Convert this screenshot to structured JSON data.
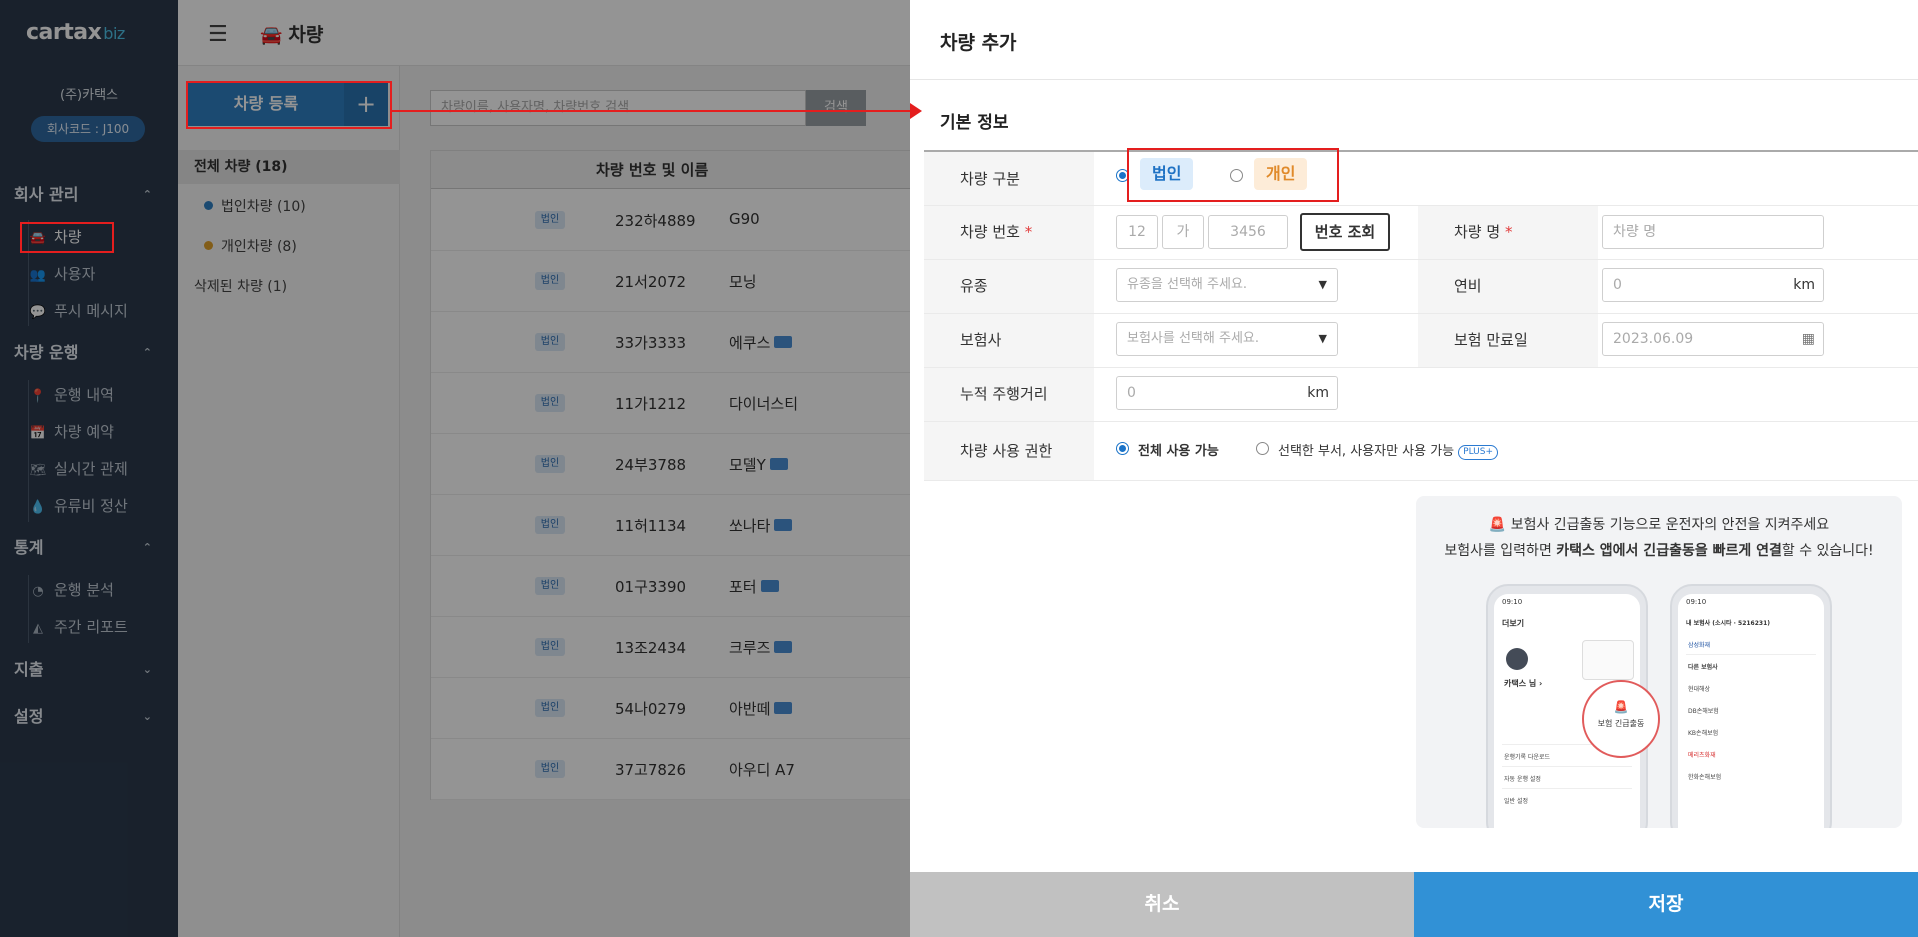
{
  "brand": {
    "logo_text": "cartax",
    "logo_suffix": "biz",
    "accent": "#3191d6",
    "sidebar_bg": "#2b3a4d"
  },
  "company": {
    "name": "(주)카택스",
    "code": "회사코드 : J100"
  },
  "sidebar": {
    "sections": [
      {
        "label": "회사 관리",
        "chevron": "⌃",
        "items": [
          {
            "label": "차량",
            "icon": "car-icon",
            "active": true
          },
          {
            "label": "사용자",
            "icon": "users-icon"
          },
          {
            "label": "푸시 메시지",
            "icon": "chat-icon"
          }
        ]
      },
      {
        "label": "차량 운행",
        "chevron": "⌃",
        "items": [
          {
            "label": "운행 내역",
            "icon": "pin-icon"
          },
          {
            "label": "차량 예약",
            "icon": "calendar-icon"
          },
          {
            "label": "실시간 관제",
            "icon": "map-icon"
          },
          {
            "label": "유류비 정산",
            "icon": "drop-icon"
          }
        ]
      },
      {
        "label": "통계",
        "chevron": "⌃",
        "items": [
          {
            "label": "운행 분석",
            "icon": "pie-icon"
          },
          {
            "label": "주간 리포트",
            "icon": "area-chart-icon"
          }
        ]
      },
      {
        "label": "지출",
        "chevron": "⌄",
        "items": []
      },
      {
        "label": "설정",
        "chevron": "⌄",
        "items": []
      }
    ]
  },
  "header": {
    "title": "차량",
    "menu_icon": "☰",
    "car_icon": "🚘"
  },
  "vehicle_panel": {
    "register_label": "차량 등록",
    "register_plus": "+",
    "all_label": "전체 차량 (18)",
    "groups": [
      {
        "label": "법인차량 (10)",
        "color": "#2f80c3"
      },
      {
        "label": "개인차량 (8)",
        "color": "#e0a12a"
      }
    ],
    "deleted_label": "삭제된 차량 (1)",
    "search_placeholder": "차량이름, 사용자명, 차량번호 검색",
    "search_button": "검색",
    "table_header": "차량 번호 및 이름",
    "rows": [
      {
        "badge": "법인",
        "plate": "232하4889",
        "model": "G90",
        "chip": false
      },
      {
        "badge": "법인",
        "plate": "21서2072",
        "model": "모닝",
        "chip": false
      },
      {
        "badge": "법인",
        "plate": "33가3333",
        "model": "에쿠스",
        "chip": true
      },
      {
        "badge": "법인",
        "plate": "11가1212",
        "model": "다이너스티",
        "chip": false
      },
      {
        "badge": "법인",
        "plate": "24부3788",
        "model": "모델Y",
        "chip": true
      },
      {
        "badge": "법인",
        "plate": "11허1134",
        "model": "쏘나타",
        "chip": true
      },
      {
        "badge": "법인",
        "plate": "01구3390",
        "model": "포터",
        "chip": true
      },
      {
        "badge": "법인",
        "plate": "13조2434",
        "model": "크루즈",
        "chip": true
      },
      {
        "badge": "법인",
        "plate": "54나0279",
        "model": "아반떼",
        "chip": true
      },
      {
        "badge": "법인",
        "plate": "37고7826",
        "model": "아우디 A7",
        "chip": false
      }
    ]
  },
  "modal": {
    "title": "차량 추가",
    "section": "기본 정보",
    "fields": {
      "type_label": "차량 구분",
      "type_corp": "법인",
      "type_personal": "개인",
      "plate_label": "차량 번호",
      "required_mark": "*",
      "plate_part1": "12",
      "plate_part2": "가",
      "plate_part3": "3456",
      "lookup_button": "번호 조회",
      "name_label": "차량 명",
      "name_placeholder": "차량 명",
      "fuel_label": "유종",
      "fuel_placeholder": "유종을 선택해 주세요.",
      "efficiency_label": "연비",
      "efficiency_value": "0",
      "efficiency_unit": "km",
      "insurer_label": "보험사",
      "insurer_placeholder": "보험사를 선택해 주세요.",
      "expiry_label": "보험 만료일",
      "expiry_value": "2023.06.09",
      "mileage_label": "누적 주행거리",
      "mileage_value": "0",
      "mileage_unit": "km",
      "permission_label": "차량 사용 권한",
      "permission_all": "전체 사용 가능",
      "permission_selected": "선택한 부서, 사용자만 사용 가능",
      "plus_badge": "PLUS+"
    },
    "promo": {
      "line1": "보험사 긴급출동 기능으로 운전자의 안전을 지켜주세요",
      "line2_a": "보험사를 입력하면 ",
      "line2_b": "카택스 앱에서  긴급출동을 빠르게 연결",
      "line2_c": "할 수 있습니다!",
      "left_phone": {
        "time": "09:10",
        "title": "더보기",
        "name": "카택스 님 ›",
        "rows": [
          "운행기록 다운로드",
          "자동 운행 설정",
          "일반 설정"
        ]
      },
      "right_phone": {
        "time": "09:10",
        "title": "내 보험사 (소시타 · 5216231)",
        "other": "다른 보험사",
        "insurers": [
          "삼성화재",
          "현대해상",
          "DB손해보험",
          "KB손해보험",
          "메리츠화재",
          "한화손해보험"
        ]
      },
      "circle_label": "보험 긴급출동"
    },
    "cancel": "취소",
    "save": "저장"
  }
}
